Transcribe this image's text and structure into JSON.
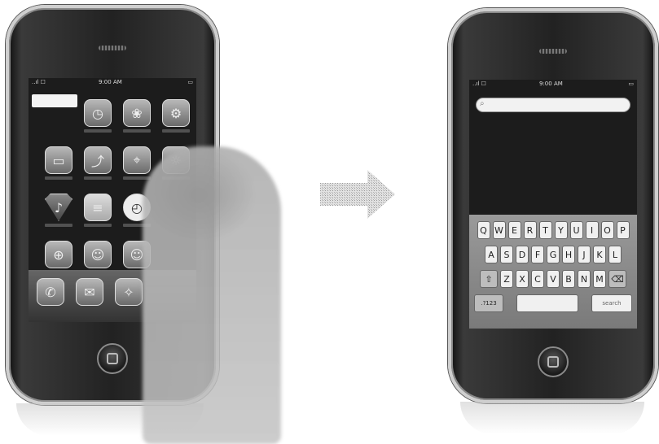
{
  "left_phone": {
    "status": {
      "signal": "..ıl ☐",
      "time": "9:00 AM",
      "battery": "▭"
    },
    "icons": [
      "calendar-icon",
      "clock-icon",
      "photos-icon",
      "settings-icon",
      "youtube-icon",
      "stocks-icon",
      "maps-icon",
      "weather-icon",
      "itunes-icon",
      "notes-icon",
      "clock-icon-2",
      "app-store-icon",
      "safari-icon",
      "mail-icon",
      "phone-icon",
      "ipod-icon"
    ],
    "dock": [
      "phone-icon",
      "mail-icon",
      "safari-icon",
      "ipod-icon"
    ]
  },
  "right_phone": {
    "status": {
      "signal": "..ıl ☐",
      "time": "9:00 AM",
      "battery": "▭"
    },
    "keyboard": {
      "row1": [
        "Q",
        "W",
        "E",
        "R",
        "T",
        "Y",
        "U",
        "I",
        "O",
        "P"
      ],
      "row2": [
        "A",
        "S",
        "D",
        "F",
        "G",
        "H",
        "J",
        "K",
        "L"
      ],
      "row3": [
        "Z",
        "X",
        "C",
        "V",
        "B",
        "N",
        "M"
      ],
      "row4_left": ".?123",
      "row4_right": "search"
    }
  }
}
